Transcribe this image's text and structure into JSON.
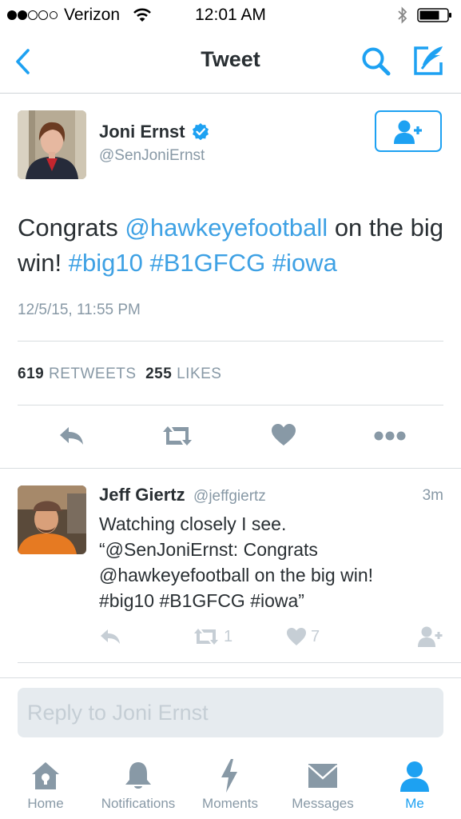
{
  "status": {
    "carrier": "Verizon",
    "time": "12:01 AM"
  },
  "nav": {
    "title": "Tweet"
  },
  "tweet": {
    "name": "Joni Ernst",
    "handle": "@SenJoniErnst",
    "text_prefix": "Congrats ",
    "mention": "@hawkeyefootball",
    "text_mid": " on the big win! ",
    "hashtags": [
      "#big10",
      "#B1GFCG",
      "#iowa"
    ],
    "timestamp": "12/5/15, 11:55 PM",
    "retweets_count": "619",
    "retweets_label": "RETWEETS",
    "likes_count": "255",
    "likes_label": "LIKES"
  },
  "reply": {
    "name": "Jeff Giertz",
    "handle": "@jeffgiertz",
    "age": "3m",
    "lines": [
      "Watching closely I see.",
      "“@SenJoniErnst: Congrats",
      "@hawkeyefootball on the big win!",
      "#big10 #B1GFCG #iowa”"
    ],
    "retweet_count": "1",
    "like_count": "7"
  },
  "composer": {
    "placeholder": "Reply to Joni Ernst"
  },
  "tabs": [
    {
      "label": "Home"
    },
    {
      "label": "Notifications"
    },
    {
      "label": "Moments"
    },
    {
      "label": "Messages"
    },
    {
      "label": "Me"
    }
  ],
  "colors": {
    "accent": "#1da1f2",
    "link": "#3ea1e4",
    "muted": "#8899a6"
  }
}
